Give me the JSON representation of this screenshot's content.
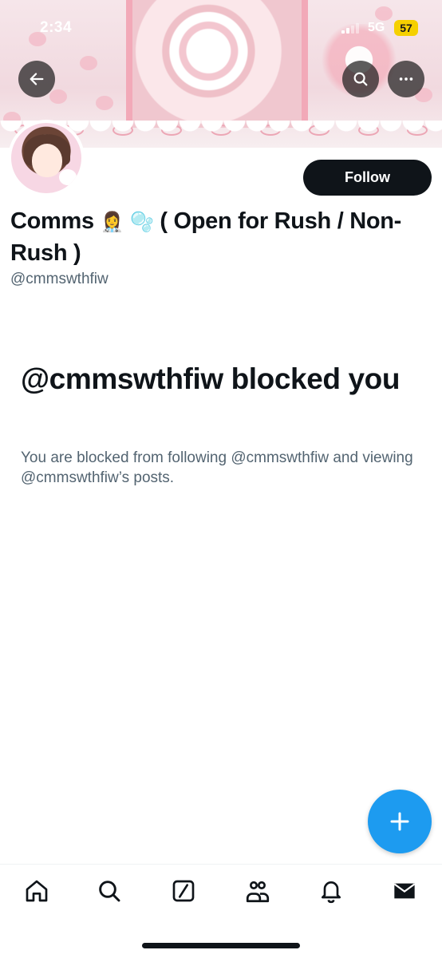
{
  "status_bar": {
    "time": "2:34",
    "network": "5G",
    "battery": "57"
  },
  "header": {
    "back_icon": "arrow-left-icon",
    "search_icon": "search-icon",
    "more_icon": "more-horizontal-icon"
  },
  "profile": {
    "follow_label": "Follow",
    "name_part1": "Comms",
    "emoji1": "👩‍⚕️",
    "emoji2": "🫧",
    "name_part2": "( Open for Rush / Non-Rush )",
    "handle": "@cmmswthfiw"
  },
  "blocked": {
    "title": "@cmmswthfiw blocked you",
    "description": "You are blocked from following @cmmswthfiw and viewing @cmmswthfiw’s posts."
  },
  "fab": {
    "icon": "plus-icon"
  },
  "bottom_nav": [
    "home-icon",
    "search-icon",
    "grok-icon",
    "communities-icon",
    "notifications-icon",
    "messages-icon"
  ],
  "colors": {
    "accent": "#1d9bf0",
    "text": "#0f1419",
    "secondary_text": "#536471",
    "battery": "#f5d000"
  }
}
